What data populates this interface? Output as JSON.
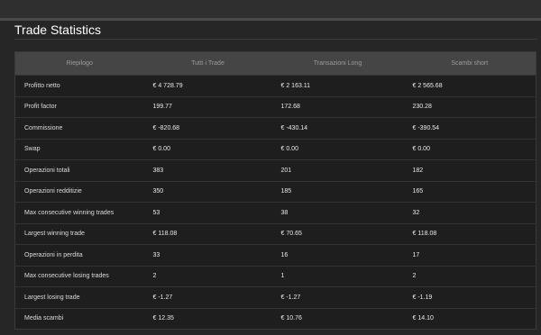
{
  "page": {
    "title": "Trade Statistics"
  },
  "table": {
    "headers": [
      "Riepilogo",
      "Tutti i Trade",
      "Transazioni Long",
      "Scambi short"
    ],
    "rows": [
      [
        "Profitto netto",
        "€ 4 728.79",
        "€ 2 163.11",
        "€ 2 565.68"
      ],
      [
        "Profit factor",
        "199.77",
        "172.68",
        "230.28"
      ],
      [
        "Commissione",
        "€ -820.68",
        "€ -430.14",
        "€ -390.54"
      ],
      [
        "Swap",
        "€ 0.00",
        "€ 0.00",
        "€ 0.00"
      ],
      [
        "Operazioni totali",
        "383",
        "201",
        "182"
      ],
      [
        "Operazioni redditizie",
        "350",
        "185",
        "165"
      ],
      [
        "Max consecutive winning trades",
        "53",
        "38",
        "32"
      ],
      [
        "Largest winning trade",
        "€ 118.08",
        "€ 70.65",
        "€ 118.08"
      ],
      [
        "Operazioni in perdita",
        "33",
        "16",
        "17"
      ],
      [
        "Max consecutive losing trades",
        "2",
        "1",
        "2"
      ],
      [
        "Largest losing trade",
        "€ -1.27",
        "€ -1.27",
        "€ -1.19"
      ],
      [
        "Media scambi",
        "€ 12.35",
        "€ 10.76",
        "€ 14.10"
      ]
    ]
  }
}
